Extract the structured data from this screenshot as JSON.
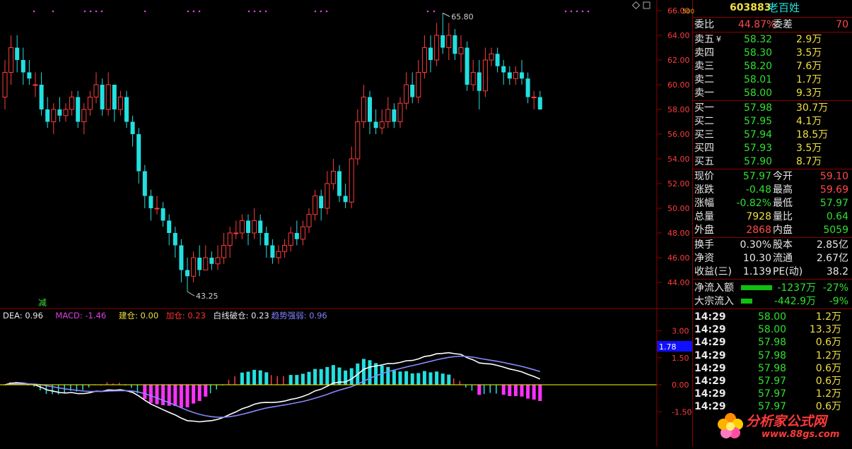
{
  "stock": {
    "code": "603883",
    "name": "老百姓",
    "small_label": "500"
  },
  "bid_ask": {
    "weibi_label": "委比",
    "weibi_value": "44.87%",
    "weicha_label": "委差",
    "weicha_value": "70",
    "asks": [
      {
        "label": "卖五",
        "mark": "¥",
        "price": "58.32",
        "vol": "2.9万"
      },
      {
        "label": "卖四",
        "price": "58.30",
        "vol": "3.5万"
      },
      {
        "label": "卖三",
        "price": "58.20",
        "vol": "7.6万"
      },
      {
        "label": "卖二",
        "price": "58.01",
        "vol": "1.7万"
      },
      {
        "label": "卖一",
        "price": "58.00",
        "vol": "9.3万"
      }
    ],
    "bids": [
      {
        "label": "买一",
        "price": "57.98",
        "vol": "30.7万"
      },
      {
        "label": "买二",
        "price": "57.95",
        "vol": "4.1万"
      },
      {
        "label": "买三",
        "price": "57.94",
        "vol": "18.5万"
      },
      {
        "label": "买四",
        "price": "57.93",
        "vol": "3.5万"
      },
      {
        "label": "买五",
        "price": "57.90",
        "vol": "8.7万"
      }
    ]
  },
  "quote": [
    {
      "l1": "现价",
      "v1": "57.97",
      "l2": "今开",
      "v2": "59.10"
    },
    {
      "l1": "涨跌",
      "v1": "-0.48",
      "l2": "最高",
      "v2": "59.69"
    },
    {
      "l1": "涨幅",
      "v1": "-0.82%",
      "l2": "最低",
      "v2": "57.97"
    },
    {
      "l1": "总量",
      "v1": "7928",
      "l2": "量比",
      "v2": "0.64"
    },
    {
      "l1": "外盘",
      "v1": "2868",
      "l2": "内盘",
      "v2": "5059"
    }
  ],
  "fundamentals": [
    {
      "l1": "换手",
      "v1": "0.30%",
      "l2": "股本",
      "v2": "2.85亿"
    },
    {
      "l1": "净资",
      "v1": "10.30",
      "l2": "流通",
      "v2": "2.67亿"
    },
    {
      "l1": "收益(三)",
      "v1": "1.139",
      "l2": "PE(动)",
      "v2": "38.2"
    }
  ],
  "flows": [
    {
      "label": "净流入额",
      "value": "-1237万",
      "pct": "-27%"
    },
    {
      "label": "大宗流入",
      "value": "-442.9万",
      "pct": "-9%"
    }
  ],
  "ticks": [
    {
      "time": "14:29",
      "price": "58.00",
      "vol": "1.2万"
    },
    {
      "time": "14:29",
      "price": "58.00",
      "vol": "13.3万"
    },
    {
      "time": "14:29",
      "price": "57.98",
      "vol": "0.6万"
    },
    {
      "time": "14:29",
      "price": "57.98",
      "vol": "1.2万"
    },
    {
      "time": "14:29",
      "price": "57.98",
      "vol": "0.6万"
    },
    {
      "time": "14:29",
      "price": "57.97",
      "vol": "0.6万"
    },
    {
      "time": "14:29",
      "price": "57.97",
      "vol": "1.2万"
    },
    {
      "time": "14:29",
      "price": "57.97",
      "vol": "0.6万"
    }
  ],
  "kline": {
    "y_ticks": [
      "66.00",
      "64.00",
      "62.00",
      "60.00",
      "58.00",
      "56.00",
      "54.00",
      "52.00",
      "50.00",
      "48.00",
      "46.00",
      "44.00"
    ],
    "high_label": "65.80",
    "low_label": "43.25",
    "signal_label": "减",
    "candles": [
      [
        59,
        61,
        62,
        58
      ],
      [
        61,
        63,
        64,
        60
      ],
      [
        63,
        62,
        64,
        61
      ],
      [
        62,
        61,
        63,
        60
      ],
      [
        61,
        60.5,
        62,
        60
      ],
      [
        60,
        60,
        61,
        59
      ],
      [
        60,
        58,
        61,
        57.5
      ],
      [
        58,
        57,
        59,
        56.5
      ],
      [
        57,
        58,
        58.5,
        56
      ],
      [
        58,
        57.5,
        59,
        57
      ],
      [
        57.5,
        58,
        58.5,
        57
      ],
      [
        58,
        59,
        59.5,
        57.5
      ],
      [
        59,
        57,
        59.5,
        56.5
      ],
      [
        57,
        58,
        58.5,
        56
      ],
      [
        58,
        59,
        59.5,
        57.5
      ],
      [
        59,
        60,
        61,
        58.5
      ],
      [
        60,
        58,
        60.5,
        57.5
      ],
      [
        58,
        60,
        61,
        57.5
      ],
      [
        60,
        58,
        60,
        57
      ],
      [
        58,
        59,
        59.5,
        57.5
      ],
      [
        59,
        57,
        59.5,
        56.5
      ],
      [
        57,
        56,
        57.5,
        55
      ],
      [
        56,
        53,
        56.5,
        52
      ],
      [
        53,
        51,
        53.5,
        50
      ],
      [
        51,
        50,
        51.5,
        49
      ],
      [
        50,
        50,
        51,
        49.5
      ],
      [
        50,
        49,
        50.5,
        48.5
      ],
      [
        49,
        48,
        49.5,
        47
      ],
      [
        48,
        47,
        48.5,
        46
      ],
      [
        47,
        45,
        47.5,
        44
      ],
      [
        45,
        44.5,
        46,
        43.25
      ],
      [
        44.5,
        46,
        46.5,
        44
      ],
      [
        46,
        45,
        47,
        44.5
      ],
      [
        45,
        46,
        47,
        45
      ],
      [
        46,
        45.5,
        46.5,
        45
      ],
      [
        45.5,
        46,
        47,
        45
      ],
      [
        46,
        47,
        48,
        45.5
      ],
      [
        47,
        48,
        48.5,
        46
      ],
      [
        48,
        48,
        49,
        47.5
      ],
      [
        48,
        49,
        49.5,
        47.5
      ],
      [
        49,
        48,
        49.5,
        47
      ],
      [
        48,
        49,
        50,
        47.5
      ],
      [
        49,
        48,
        49.5,
        47
      ],
      [
        48,
        47,
        48.5,
        46
      ],
      [
        47,
        46,
        47.5,
        45.5
      ],
      [
        46,
        46.5,
        47,
        45.5
      ],
      [
        46.5,
        47,
        47.5,
        46
      ],
      [
        47,
        48,
        48.5,
        46.5
      ],
      [
        48,
        47.5,
        49,
        47
      ],
      [
        47.5,
        48.5,
        49,
        47
      ],
      [
        48.5,
        49.5,
        50,
        48
      ],
      [
        49.5,
        51,
        51.5,
        49
      ],
      [
        51,
        50,
        51.5,
        49
      ],
      [
        50,
        52,
        53,
        49.5
      ],
      [
        52,
        53,
        54,
        51.5
      ],
      [
        53,
        51,
        53.5,
        50.5
      ],
      [
        51,
        50.5,
        52,
        50
      ],
      [
        50.5,
        54,
        55,
        50
      ],
      [
        54,
        57,
        58,
        53.5
      ],
      [
        57,
        59,
        60,
        56.5
      ],
      [
        59,
        57,
        59.5,
        56
      ],
      [
        57,
        56.5,
        58,
        56
      ],
      [
        56.5,
        57,
        58,
        56
      ],
      [
        57,
        58,
        59,
        56.5
      ],
      [
        58,
        57,
        58.5,
        56.5
      ],
      [
        57,
        58.5,
        59,
        56.5
      ],
      [
        58.5,
        60,
        61,
        58
      ],
      [
        60,
        59,
        61,
        58.5
      ],
      [
        59,
        61,
        62,
        58.5
      ],
      [
        61,
        63,
        64,
        60.5
      ],
      [
        63,
        62,
        64,
        61
      ],
      [
        62,
        64,
        65,
        61.5
      ],
      [
        64,
        63,
        65.8,
        62.5
      ],
      [
        63,
        64,
        65,
        62
      ],
      [
        64,
        62.5,
        64.5,
        62
      ],
      [
        62.5,
        63,
        64,
        61
      ],
      [
        63,
        60,
        63.5,
        59.5
      ],
      [
        60,
        61,
        62,
        59.5
      ],
      [
        61,
        59.5,
        62,
        58
      ],
      [
        59.5,
        62,
        63,
        59
      ],
      [
        62,
        62.5,
        63,
        61.5
      ],
      [
        62.5,
        61.5,
        63,
        61
      ],
      [
        61.5,
        61,
        62,
        60
      ],
      [
        61,
        60.5,
        61.5,
        60
      ],
      [
        60.5,
        61,
        61.5,
        60
      ],
      [
        61,
        60.5,
        62,
        60
      ],
      [
        60.5,
        59,
        61,
        58.5
      ],
      [
        59,
        59,
        59.5,
        58
      ],
      [
        59,
        58,
        59.5,
        57.97
      ]
    ]
  },
  "macd": {
    "legend": [
      {
        "text": "DEA: 0.96",
        "color": "#e8e8e8"
      },
      {
        "text": "MACD: -1.46",
        "color": "#e040e0"
      },
      {
        "text": "建仓: 0.00",
        "color": "#f0e040"
      },
      {
        "text": "加仓: 0.23",
        "color": "#ff3030"
      },
      {
        "text": "白线破仓: 0.23",
        "color": "#e8e8e8"
      },
      {
        "text": "趋势强弱: 0.96",
        "color": "#8080ff"
      }
    ],
    "y_ticks": [
      "3.00",
      "1.50",
      "0.00",
      "-1.50"
    ],
    "current_label": "1.78"
  },
  "colors": {
    "up": "#ff3c3c",
    "down": "#22e0e0",
    "grid": "#8a0000",
    "dif": "#ffffff",
    "dea": "#8888ff"
  },
  "watermark": {
    "brand": "分析家公式网",
    "url": "www.88gs.com"
  }
}
